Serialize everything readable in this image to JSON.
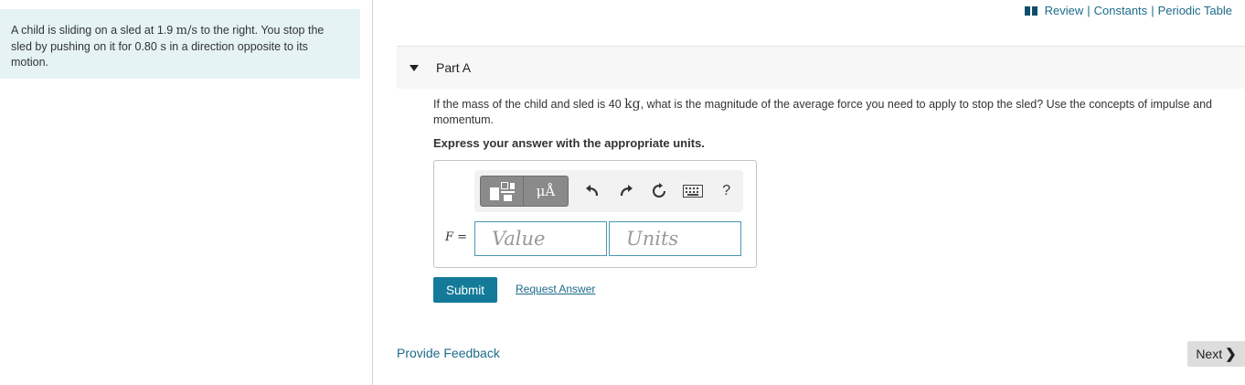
{
  "problem": {
    "line1_a": "A child is sliding on a sled at 1.9 ",
    "line1_unit": "m/s",
    "line1_b": " to the right. You stop the",
    "line2_a": "sled by pushing on it for 0.80 ",
    "line2_unit": "s",
    "line2_b": " in a direction opposite to its",
    "line3": "motion."
  },
  "top_links": {
    "review": "Review",
    "sep": "|",
    "constants": "Constants",
    "periodic_table": "Periodic Table"
  },
  "part": {
    "title": "Part A"
  },
  "question": {
    "text_a": "If the mass of the child and sled is 40 ",
    "unit": "kg",
    "text_b": ", what is the magnitude of the average force you need to apply to stop the sled? Use the concepts of impulse and",
    "text_c": "momentum."
  },
  "instruction": "Express your answer with the appropriate units.",
  "toolbar": {
    "units_label": "μÅ",
    "help_label": "?"
  },
  "answer": {
    "variable": "F",
    "equals": "=",
    "value_placeholder": "Value",
    "units_placeholder": "Units"
  },
  "buttons": {
    "submit": "Submit",
    "request_answer": "Request Answer",
    "provide_feedback": "Provide Feedback",
    "next": "Next"
  },
  "colors": {
    "accent": "#147a9a",
    "link": "#1d6b8a",
    "problem_bg": "#e5f3f5"
  }
}
